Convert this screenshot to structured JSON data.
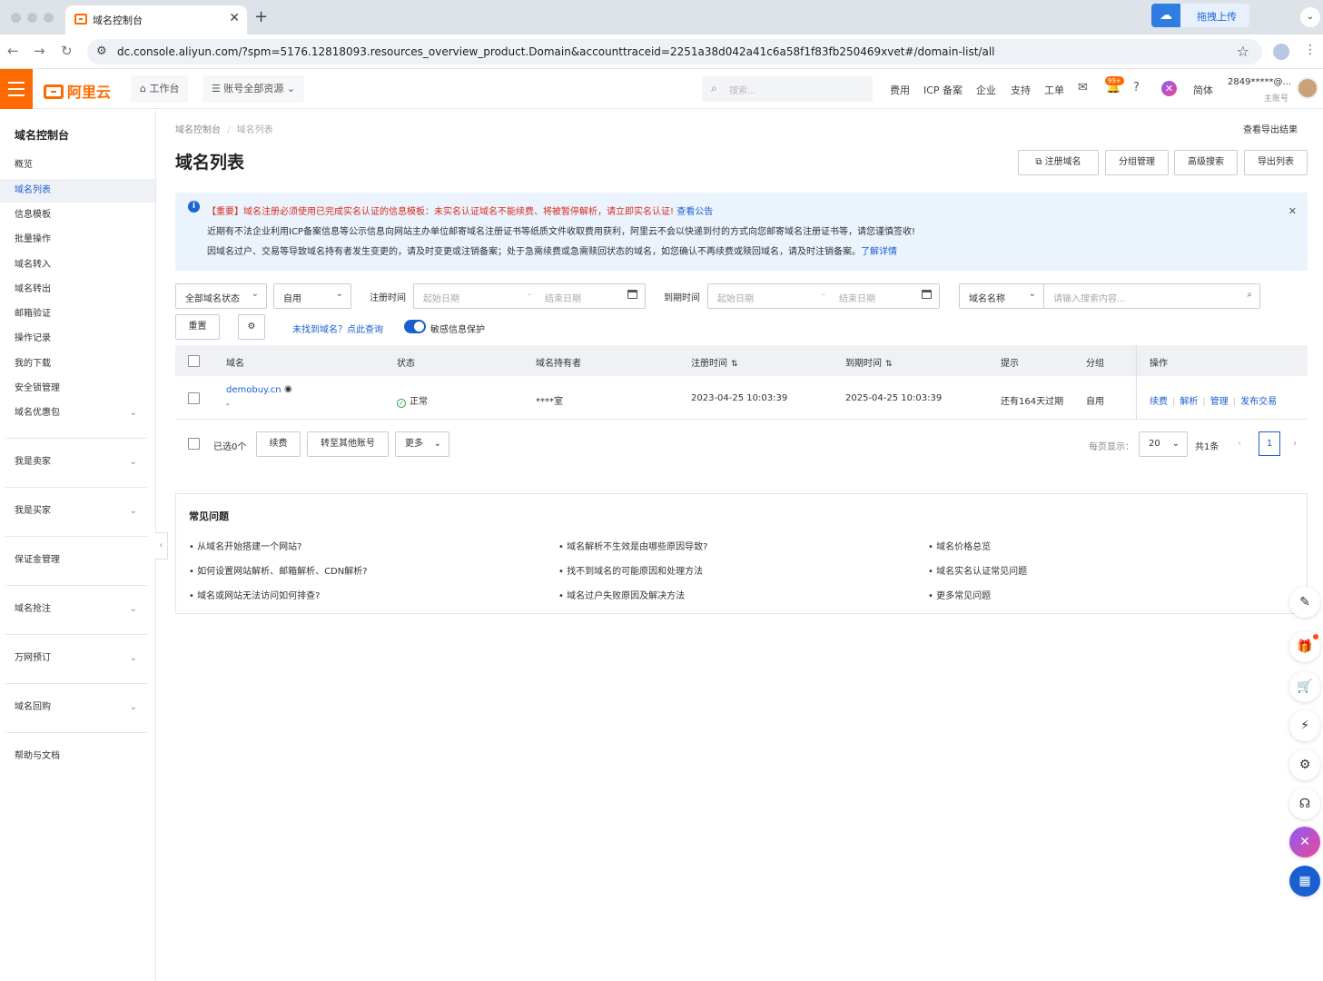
{
  "browser": {
    "tab_title": "域名控制台",
    "new_tab_symbol": "+",
    "tab_close": "✕",
    "extension_label": "拖拽上传",
    "url": "dc.console.aliyun.com/?spm=5176.12818093.resources_overview_product.Domain&accounttraceid=2251a38d042a41c6a58f1f83fb250469xvet#/domain-list/all"
  },
  "topnav": {
    "logo": "阿里云",
    "workbench": "工作台",
    "resources": "账号全部资源",
    "search_placeholder": "搜索...",
    "links": [
      "费用",
      "ICP 备案",
      "企业",
      "支持",
      "工单"
    ],
    "badge": "99+",
    "lang": "简体",
    "account": "2849*****@...",
    "account_sub": "主账号"
  },
  "sidebar": {
    "title": "域名控制台",
    "items": [
      "概览",
      "域名列表",
      "信息模板",
      "批量操作",
      "域名转入",
      "域名转出",
      "邮箱验证",
      "操作记录",
      "我的下载",
      "安全锁管理",
      "域名优惠包"
    ],
    "groups": [
      "我是卖家",
      "我是买家",
      "保证金管理",
      "域名抢注",
      "万网预订",
      "域名回购",
      "帮助与文档"
    ]
  },
  "main": {
    "breadcrumb": [
      "域名控制台",
      "域名列表"
    ],
    "export_result": "查看导出结果",
    "title": "域名列表",
    "header_buttons": [
      "注册域名",
      "分组管理",
      "高级搜索",
      "导出列表"
    ],
    "notice": {
      "line1_red": "【重要】域名注册必须使用已完成实名认证的信息模板：未实名认证域名不能续费、将被暂停解析，请立即实名认证!",
      "line1_link": "查看公告",
      "line2": "近期有不法企业利用ICP备案信息等公示信息向网站主办单位邮寄域名注册证书等纸质文件收取费用获利，阿里云不会以快递到付的方式向您邮寄域名注册证书等，请您谨慎签收!",
      "line3": "因域名过户、交易等导致域名持有者发生变更的，请及时变更或注销备案；处于急需续费或急需赎回状态的域名，如您确认不再续费或赎回域名，请及时注销备案。",
      "line3_link": "了解详情"
    },
    "filters": {
      "status": "全部域名状态",
      "usage": "自用",
      "reg_time_label": "注册时间",
      "exp_time_label": "到期时间",
      "start_ph": "起始日期",
      "end_ph": "结束日期",
      "name_type": "域名名称",
      "search_ph": "请输入搜索内容..."
    },
    "reset_label": "重置",
    "not_found_link": "未找到域名？点此查询",
    "privacy_label": "敏感信息保护",
    "table": {
      "headers": [
        "域名",
        "状态",
        "域名持有者",
        "注册时间",
        "到期时间",
        "提示",
        "分组",
        "操作"
      ],
      "rows": [
        {
          "domain": "demobuy.cn",
          "sub": "-",
          "status": "正常",
          "owner": "****室",
          "reg": "2023-04-25 10:03:39",
          "exp": "2025-04-25 10:03:39",
          "tip": "还有164天过期",
          "group": "自用",
          "ops": [
            "续费",
            "解析",
            "管理",
            "发布交易"
          ]
        }
      ]
    },
    "footer": {
      "selected": "已选0个",
      "renew": "续费",
      "transfer": "转至其他账号",
      "more": "更多",
      "per_page_label": "每页显示：",
      "per_page": "20",
      "total": "共1条",
      "current_page": "1"
    },
    "faq": {
      "title": "常见问题",
      "items": [
        "从域名开始搭建一个网站?",
        "域名解析不生效是由哪些原因导致?",
        "域名价格总览",
        "如何设置网站解析、邮箱解析、CDN解析?",
        "找不到域名的可能原因和处理方法",
        "域名实名认证常见问题",
        "域名或网站无法访问如何排查?",
        "域名过户失败原因及解决方法",
        "更多常见问题"
      ]
    }
  },
  "colors": {
    "brand": "#ff6a00",
    "link": "#1a5fd0",
    "notice_bg": "#ebf3fd",
    "danger": "#d72c1f",
    "success": "#24a148"
  }
}
